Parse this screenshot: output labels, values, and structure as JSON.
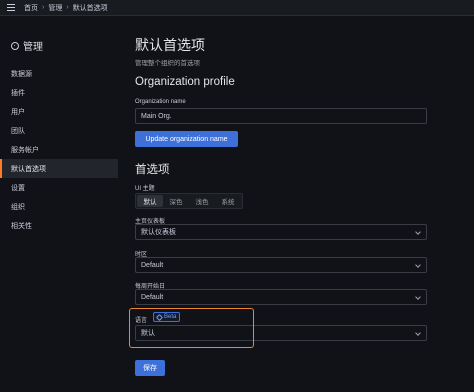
{
  "breadcrumb": {
    "home": "首页",
    "admin": "管理",
    "current": "默认首选项"
  },
  "sidebar": {
    "title": "管理",
    "items": [
      {
        "label": "数据源"
      },
      {
        "label": "插件"
      },
      {
        "label": "用户"
      },
      {
        "label": "团队"
      },
      {
        "label": "服务帐户"
      },
      {
        "label": "默认首选项",
        "active": true
      },
      {
        "label": "设置"
      },
      {
        "label": "组织"
      },
      {
        "label": "相关性"
      }
    ]
  },
  "main": {
    "title": "默认首选项",
    "subtitle": "管理整个组织的首选项",
    "org_profile": {
      "heading": "Organization profile",
      "name_label": "Organization name",
      "name_value": "Main Org.",
      "update_button": "Update organization name"
    },
    "prefs": {
      "heading": "首选项",
      "theme_label": "UI 主题",
      "theme_options": [
        "默认",
        "深色",
        "浅色",
        "系统"
      ],
      "theme_selected": "默认",
      "home_dashboard_label": "主页仪表板",
      "home_dashboard_value": "默认仪表板",
      "timezone_label": "时区",
      "timezone_value": "Default",
      "week_start_label": "每周开始日",
      "week_start_value": "Default",
      "language_label": "语言",
      "language_badge": "Beta",
      "language_value": "默认",
      "save_button": "保存"
    }
  },
  "colors": {
    "accent": "#3d71d9",
    "active_marker": "#ff7a24",
    "highlight": "#f0862c"
  }
}
